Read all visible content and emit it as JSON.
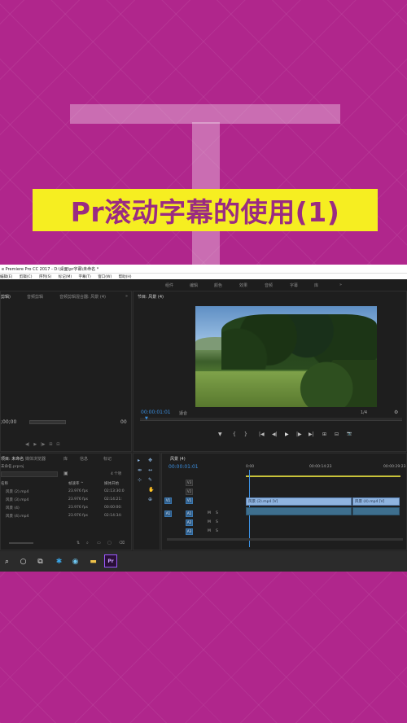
{
  "banner": {
    "title": "Pr滚动字幕的使用(1)"
  },
  "window": {
    "title": "e Premiere Pro CC 2017 - D:\\桌面\\pr字幕\\未命名 *",
    "menu": [
      "编辑(E)",
      "剪辑(C)",
      "序列(S)",
      "标记(M)",
      "字幕(T)",
      "窗口(W)",
      "帮助(H)"
    ],
    "workspaces": [
      "组件",
      "编辑",
      "颜色",
      "效果",
      "音频",
      "字幕",
      "库",
      "»"
    ]
  },
  "source_panel": {
    "tabs": [
      "剪辑)",
      "音频剪辑",
      "音频剪辑混合器: 风景 (4)",
      "»"
    ],
    "timecode": ";00;00",
    "page": "00"
  },
  "program_panel": {
    "tab": "节目: 风景 (4)",
    "timecode": "00:00:01:01",
    "fit": "适合",
    "ratio": "1/4",
    "controls": [
      "▼",
      "{",
      "}",
      "|◀",
      "◀|",
      "▶",
      "|▶",
      "▶|",
      "⊞",
      "⊟",
      "📷"
    ]
  },
  "project_panel": {
    "tabs": [
      "项目: 未命名",
      "媒体浏览器",
      "库",
      "信息",
      "标记"
    ],
    "path": "未命名.prproj",
    "count": "4 个项",
    "columns": [
      "名称",
      "帧速率 ^",
      "媒体开始"
    ],
    "rows": [
      {
        "name": "风景 (2).mp4",
        "fps": "23.976 fps",
        "start": "02:13:30:0"
      },
      {
        "name": "风景 (3).mp4",
        "fps": "23.976 fps",
        "start": "02:14:21:"
      },
      {
        "name": "风景 (4)",
        "fps": "23.976 fps",
        "start": "00:00:00:"
      },
      {
        "name": "风景 (4).mp4",
        "fps": "23.976 fps",
        "start": "02:14:34:"
      }
    ]
  },
  "timeline_panel": {
    "tab": "风景 (4)",
    "timecode": "00:00:01:01",
    "ruler": [
      "0:00",
      "00:00:14:23",
      "00:00:29:23"
    ],
    "video_tracks": [
      "V3",
      "V2",
      "V1"
    ],
    "audio_tracks": [
      "A1",
      "A2",
      "A3"
    ],
    "source_patch": [
      "V1",
      "A1"
    ],
    "clips": [
      "风景 (2).mp4 [V]",
      "风景 (4).mp4 [V]"
    ],
    "audio_buttons": [
      "M",
      "S"
    ]
  },
  "tools": [
    "▸",
    "✥",
    "⇹",
    "↔",
    "⊹",
    "✎",
    "✋",
    "⊕"
  ],
  "taskbar": {
    "icons": [
      "search-icon",
      "cortana-icon",
      "task-view-icon",
      "app-icon",
      "browser-icon",
      "folder-icon",
      "premiere-icon"
    ],
    "premiere_label": "Pr"
  },
  "colors": {
    "background": "#b0268c",
    "banner_bg": "#f6ee21",
    "banner_text": "#9a2b82",
    "timecode_blue": "#3b8fe0"
  }
}
